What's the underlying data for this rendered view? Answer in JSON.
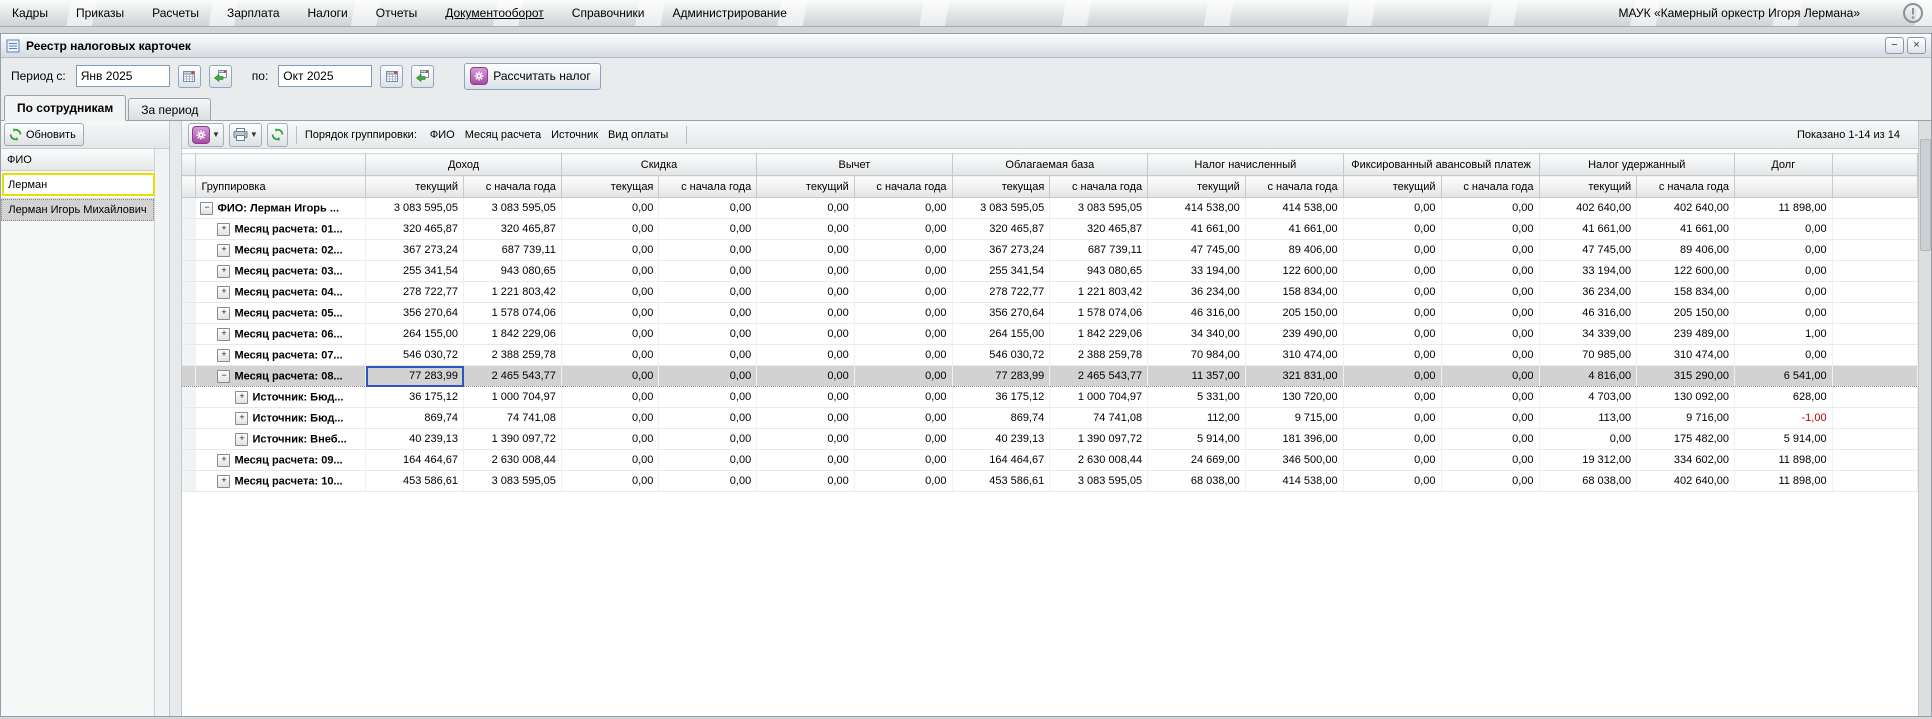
{
  "menu": {
    "items": [
      {
        "label": "Кадры",
        "underline": false
      },
      {
        "label": "Приказы",
        "underline": false
      },
      {
        "label": "Расчеты",
        "underline": false
      },
      {
        "label": "Зарплата",
        "underline": false
      },
      {
        "label": "Налоги",
        "underline": false
      },
      {
        "label": "Отчеты",
        "underline": false
      },
      {
        "label": "Документооборот",
        "underline": true
      },
      {
        "label": "Справочники",
        "underline": false
      },
      {
        "label": "Администрирование",
        "underline": false
      }
    ],
    "company": "МАУК «Камерный оркестр Игоря Лермана»"
  },
  "window": {
    "title": "Реестр налоговых карточек",
    "minimize_glyph": "−",
    "close_glyph": "×"
  },
  "toolbar": {
    "period_from_label": "Период с:",
    "period_from": "Янв 2025",
    "period_to_label": "по:",
    "period_to": "Окт 2025",
    "calc_button": "Рассчитать налог"
  },
  "tabs": [
    {
      "label": "По сотрудникам",
      "active": true
    },
    {
      "label": "За период",
      "active": false
    }
  ],
  "left_panel": {
    "refresh_label": "Обновить",
    "column_header": "ФИО",
    "filter_value": "Лерман",
    "items": [
      {
        "label": "Лерман Игорь Михайлович",
        "selected": true
      }
    ]
  },
  "grid_toolbar": {
    "grouping_label": "Порядок группировки:",
    "grouping_items": [
      "ФИО",
      "Месяц расчета",
      "Источник",
      "Вид оплаты"
    ],
    "shown_text": "Показано 1-14 из 14"
  },
  "table": {
    "group_column_header": "Группировка",
    "column_groups": [
      {
        "label": "Доход",
        "subs": [
          "текущий",
          "с начала года"
        ]
      },
      {
        "label": "Скидка",
        "subs": [
          "текущая",
          "с начала года"
        ]
      },
      {
        "label": "Вычет",
        "subs": [
          "текущий",
          "с начала года"
        ]
      },
      {
        "label": "Облагаемая база",
        "subs": [
          "текущая",
          "с начала года"
        ]
      },
      {
        "label": "Налог начисленный",
        "subs": [
          "текущий",
          "с начала года"
        ]
      },
      {
        "label": "Фиксированный авансовый платеж",
        "subs": [
          "текущий",
          "с начала года"
        ]
      },
      {
        "label": "Налог удержанный",
        "subs": [
          "текущий",
          "с начала года"
        ]
      },
      {
        "label": "Долг",
        "subs": []
      }
    ],
    "rows": [
      {
        "label": "ФИО: Лерман Игорь ...",
        "level": 0,
        "expand": "minus",
        "selected": false,
        "focus_index": null,
        "values": [
          "3 083 595,05",
          "3 083 595,05",
          "0,00",
          "0,00",
          "0,00",
          "0,00",
          "3 083 595,05",
          "3 083 595,05",
          "414 538,00",
          "414 538,00",
          "0,00",
          "0,00",
          "402 640,00",
          "402 640,00",
          "11 898,00"
        ]
      },
      {
        "label": "Месяц расчета: 01...",
        "level": 1,
        "expand": "plus",
        "selected": false,
        "focus_index": null,
        "values": [
          "320 465,87",
          "320 465,87",
          "0,00",
          "0,00",
          "0,00",
          "0,00",
          "320 465,87",
          "320 465,87",
          "41 661,00",
          "41 661,00",
          "0,00",
          "0,00",
          "41 661,00",
          "41 661,00",
          "0,00"
        ]
      },
      {
        "label": "Месяц расчета: 02...",
        "level": 1,
        "expand": "plus",
        "selected": false,
        "focus_index": null,
        "values": [
          "367 273,24",
          "687 739,11",
          "0,00",
          "0,00",
          "0,00",
          "0,00",
          "367 273,24",
          "687 739,11",
          "47 745,00",
          "89 406,00",
          "0,00",
          "0,00",
          "47 745,00",
          "89 406,00",
          "0,00"
        ]
      },
      {
        "label": "Месяц расчета: 03...",
        "level": 1,
        "expand": "plus",
        "selected": false,
        "focus_index": null,
        "values": [
          "255 341,54",
          "943 080,65",
          "0,00",
          "0,00",
          "0,00",
          "0,00",
          "255 341,54",
          "943 080,65",
          "33 194,00",
          "122 600,00",
          "0,00",
          "0,00",
          "33 194,00",
          "122 600,00",
          "0,00"
        ]
      },
      {
        "label": "Месяц расчета: 04...",
        "level": 1,
        "expand": "plus",
        "selected": false,
        "focus_index": null,
        "values": [
          "278 722,77",
          "1 221 803,42",
          "0,00",
          "0,00",
          "0,00",
          "0,00",
          "278 722,77",
          "1 221 803,42",
          "36 234,00",
          "158 834,00",
          "0,00",
          "0,00",
          "36 234,00",
          "158 834,00",
          "0,00"
        ]
      },
      {
        "label": "Месяц расчета: 05...",
        "level": 1,
        "expand": "plus",
        "selected": false,
        "focus_index": null,
        "values": [
          "356 270,64",
          "1 578 074,06",
          "0,00",
          "0,00",
          "0,00",
          "0,00",
          "356 270,64",
          "1 578 074,06",
          "46 316,00",
          "205 150,00",
          "0,00",
          "0,00",
          "46 316,00",
          "205 150,00",
          "0,00"
        ]
      },
      {
        "label": "Месяц расчета: 06...",
        "level": 1,
        "expand": "plus",
        "selected": false,
        "focus_index": null,
        "values": [
          "264 155,00",
          "1 842 229,06",
          "0,00",
          "0,00",
          "0,00",
          "0,00",
          "264 155,00",
          "1 842 229,06",
          "34 340,00",
          "239 490,00",
          "0,00",
          "0,00",
          "34 339,00",
          "239 489,00",
          "1,00"
        ]
      },
      {
        "label": "Месяц расчета: 07...",
        "level": 1,
        "expand": "plus",
        "selected": false,
        "focus_index": null,
        "values": [
          "546 030,72",
          "2 388 259,78",
          "0,00",
          "0,00",
          "0,00",
          "0,00",
          "546 030,72",
          "2 388 259,78",
          "70 984,00",
          "310 474,00",
          "0,00",
          "0,00",
          "70 985,00",
          "310 474,00",
          "0,00"
        ]
      },
      {
        "label": "Месяц расчета: 08...",
        "level": 1,
        "expand": "minus",
        "selected": true,
        "focus_index": 0,
        "values": [
          "77 283,99",
          "2 465 543,77",
          "0,00",
          "0,00",
          "0,00",
          "0,00",
          "77 283,99",
          "2 465 543,77",
          "11 357,00",
          "321 831,00",
          "0,00",
          "0,00",
          "4 816,00",
          "315 290,00",
          "6 541,00"
        ]
      },
      {
        "label": "Источник: Бюд...",
        "level": 2,
        "expand": "plus",
        "selected": false,
        "focus_index": null,
        "values": [
          "36 175,12",
          "1 000 704,97",
          "0,00",
          "0,00",
          "0,00",
          "0,00",
          "36 175,12",
          "1 000 704,97",
          "5 331,00",
          "130 720,00",
          "0,00",
          "0,00",
          "4 703,00",
          "130 092,00",
          "628,00"
        ]
      },
      {
        "label": "Источник: Бюд...",
        "level": 2,
        "expand": "plus",
        "selected": false,
        "focus_index": null,
        "values": [
          "869,74",
          "74 741,08",
          "0,00",
          "0,00",
          "0,00",
          "0,00",
          "869,74",
          "74 741,08",
          "112,00",
          "9 715,00",
          "0,00",
          "0,00",
          "113,00",
          "9 716,00",
          "-1,00"
        ]
      },
      {
        "label": "Источник: Внеб...",
        "level": 2,
        "expand": "plus",
        "selected": false,
        "focus_index": null,
        "values": [
          "40 239,13",
          "1 390 097,72",
          "0,00",
          "0,00",
          "0,00",
          "0,00",
          "40 239,13",
          "1 390 097,72",
          "5 914,00",
          "181 396,00",
          "0,00",
          "0,00",
          "0,00",
          "175 482,00",
          "5 914,00"
        ]
      },
      {
        "label": "Месяц расчета: 09...",
        "level": 1,
        "expand": "plus",
        "selected": false,
        "focus_index": null,
        "values": [
          "164 464,67",
          "2 630 008,44",
          "0,00",
          "0,00",
          "0,00",
          "0,00",
          "164 464,67",
          "2 630 008,44",
          "24 669,00",
          "346 500,00",
          "0,00",
          "0,00",
          "19 312,00",
          "334 602,00",
          "11 898,00"
        ]
      },
      {
        "label": "Месяц расчета: 10...",
        "level": 1,
        "expand": "plus",
        "selected": false,
        "focus_index": null,
        "values": [
          "453 586,61",
          "3 083 595,05",
          "0,00",
          "0,00",
          "0,00",
          "0,00",
          "453 586,61",
          "3 083 595,05",
          "68 038,00",
          "414 538,00",
          "0,00",
          "0,00",
          "68 038,00",
          "402 640,00",
          "11 898,00"
        ]
      }
    ]
  },
  "glyphs": {
    "expand_plus": "+",
    "expand_minus": "−",
    "caret": "▼"
  },
  "colors": {
    "focus_cell_border": "#2f55b8",
    "selected_row": "#d2d2d2",
    "negative_value": "#c00000",
    "filter_border": "#e6df00",
    "gear_purple": "#a64ca6",
    "refresh_green": "#2e9e2e"
  }
}
